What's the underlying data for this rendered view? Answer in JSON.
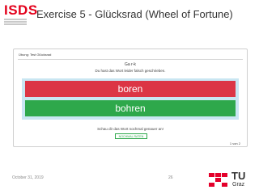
{
  "branding": {
    "logo_text": "ISDS"
  },
  "slide": {
    "title": "Exercise 5 - Glücksrad (Wheel of Fortune)"
  },
  "quiz": {
    "title": "Übung: Test Glücksrad",
    "word": "Ga r-k",
    "feedback": "Du hast das Wort leider falsch geschrieben.",
    "options": [
      "boren",
      "bohren"
    ],
    "hint": "Schau dir das Wort nochmal genauer an!",
    "retry_label": "NOCHMAL RATEN",
    "page_count": "1 von 2",
    "colors": {
      "wrong": "#dc3545",
      "right": "#2ea84b",
      "wheel_bg": "#c9e6f2"
    }
  },
  "footer": {
    "date": "October 31, 2019",
    "page": "26",
    "uni_name": "TU",
    "uni_sub": "Graz"
  }
}
